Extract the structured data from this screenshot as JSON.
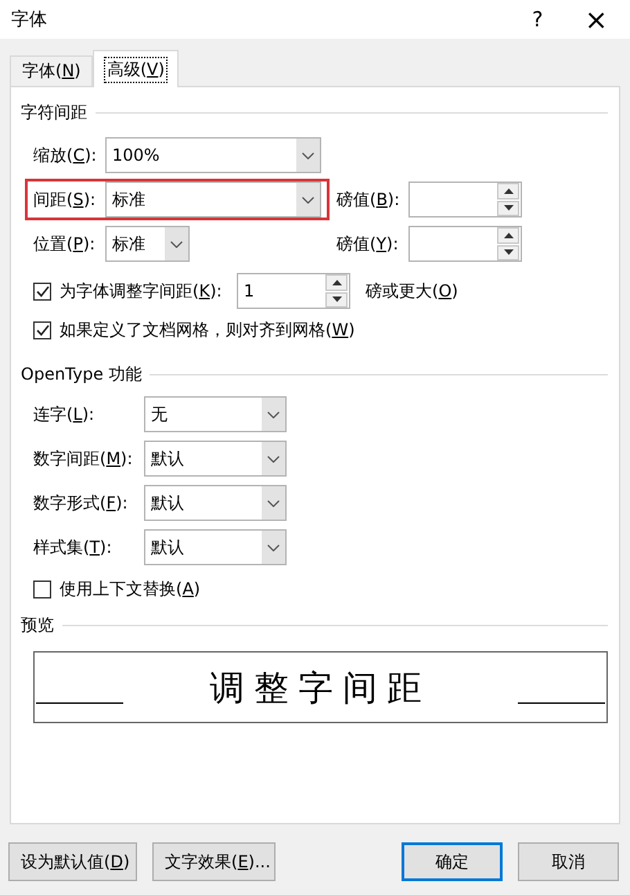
{
  "window": {
    "title": "字体",
    "help": "?",
    "close": "×"
  },
  "tabs": [
    {
      "label": [
        "字体(",
        "N",
        ")"
      ],
      "selected": false
    },
    {
      "label": [
        "高级(",
        "V",
        ")"
      ],
      "selected": true
    }
  ],
  "character_spacing": {
    "title": "字符间距",
    "rows": [
      {
        "label": [
          "缩放(",
          "C",
          "):"
        ],
        "value": "100%",
        "kind": "wide",
        "highlighted": false
      },
      {
        "label": [
          "间距(",
          "S",
          "):"
        ],
        "value": "标准",
        "kind": "wide",
        "highlighted": true,
        "points": {
          "label": [
            "磅值(",
            "B",
            "):"
          ]
        }
      },
      {
        "label": [
          "位置(",
          "P",
          "):"
        ],
        "value": "标准",
        "kind": "narrow",
        "highlighted": false,
        "points": {
          "label": [
            "磅值(",
            "Y",
            "):"
          ]
        }
      }
    ],
    "kerning": {
      "checked": true,
      "label": [
        "为字体调整字间距(",
        "K",
        "):"
      ],
      "value": "1",
      "suffix": [
        "磅或更大(",
        "O",
        ")"
      ]
    },
    "snap_to_grid": {
      "checked": true,
      "label": [
        "如果定义了文档网格，则对齐到网格(",
        "W",
        ")"
      ]
    }
  },
  "opentype": {
    "title": "OpenType 功能",
    "rows": [
      {
        "label": [
          "连字(",
          "L",
          "):"
        ],
        "value": "无"
      },
      {
        "label": [
          "数字间距(",
          "M",
          "):"
        ],
        "value": "默认"
      },
      {
        "label": [
          "数字形式(",
          "F",
          "):"
        ],
        "value": "默认"
      },
      {
        "label": [
          "样式集(",
          "T",
          "):"
        ],
        "value": "默认"
      }
    ],
    "contextual_alternates": {
      "checked": false,
      "label": [
        "使用上下文替换(",
        "A",
        ")"
      ]
    }
  },
  "preview": {
    "title": "预览",
    "sample": "调整字间距"
  },
  "buttons": [
    {
      "label": [
        "设为默认值(",
        "D",
        ")"
      ],
      "kind": "normal"
    },
    {
      "label": [
        "文字效果(",
        "E",
        ")..."
      ],
      "kind": "normal"
    },
    {
      "label": [
        "确定"
      ],
      "kind": "default"
    },
    {
      "label": [
        "取消"
      ],
      "kind": "normal"
    }
  ]
}
